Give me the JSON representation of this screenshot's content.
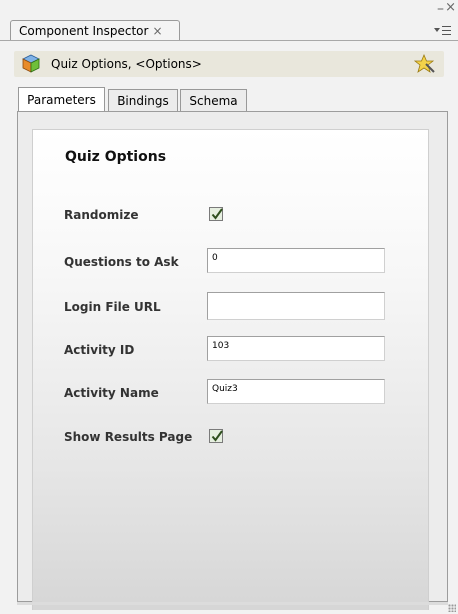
{
  "window": {
    "tab_title": "Component Inspector",
    "tab_close": "×",
    "minimize": "–",
    "close": "×"
  },
  "component": {
    "name": "Quiz Options, <Options>"
  },
  "tabs": [
    {
      "label": "Parameters",
      "active": true
    },
    {
      "label": "Bindings",
      "active": false
    },
    {
      "label": "Schema",
      "active": false
    }
  ],
  "form": {
    "title": "Quiz Options",
    "randomize": {
      "label": "Randomize",
      "checked": true
    },
    "questions_to_ask": {
      "label": "Questions to Ask",
      "value": "0"
    },
    "login_file_url": {
      "label": "Login File URL",
      "value": ""
    },
    "activity_id": {
      "label": "Activity ID",
      "value": "103"
    },
    "activity_name": {
      "label": "Activity Name",
      "value": "Quiz3"
    },
    "show_results_page": {
      "label": "Show Results Page",
      "checked": true
    }
  },
  "colors": {
    "component_bar": "#e9e7dc",
    "checkbox_fill": "#e6efe0",
    "checkmark": "#2f4f1e"
  }
}
